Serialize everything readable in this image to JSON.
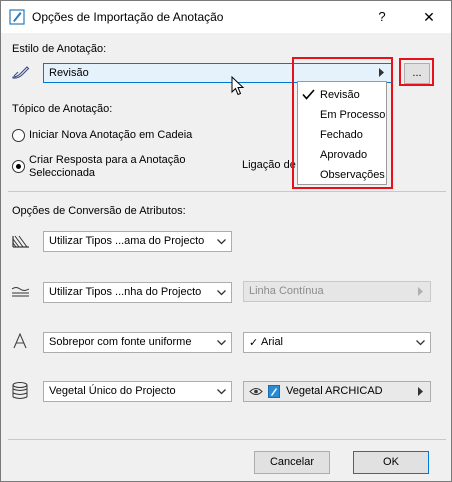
{
  "window": {
    "title": "Opções de Importação de Anotação",
    "help_glyph": "?",
    "close_glyph": "✕"
  },
  "style_section": {
    "label": "Estilo de Anotação:",
    "selected": "Revisão",
    "more_button": "...",
    "menu_items": [
      "Revisão",
      "Em Processo",
      "Fechado",
      "Aprovado",
      "Observações"
    ],
    "menu_checked_index": 0
  },
  "topic_section": {
    "label": "Tópico de Anotação:",
    "option_new": "Iniciar Nova Anotação em Cadeia",
    "option_reply_line1": "Criar Resposta para a Anotação",
    "option_reply_line2": "Seleccionada",
    "link_label": "Ligação de",
    "selected_option": "reply"
  },
  "conversion_section": {
    "label": "Opções de Conversão de Atributos:",
    "rows": [
      {
        "icon": "fill-pattern-icon",
        "combo": "Utilizar Tipos ...ama do Projecto"
      },
      {
        "icon": "line-type-icon",
        "combo": "Utilizar Tipos ...nha do Projecto",
        "secondary": "Linha Contínua",
        "secondary_disabled": true
      },
      {
        "icon": "font-icon",
        "combo": "Sobrepor com fonte uniforme",
        "secondary": "Arial",
        "secondary_check": "✓"
      },
      {
        "icon": "pen-set-icon",
        "combo": "Vegetal Único do Projecto",
        "secondary": "Vegetal ARCHICAD"
      }
    ]
  },
  "footer": {
    "cancel_label": "Cancelar",
    "ok_label": "OK"
  },
  "colors": {
    "highlight_red": "#e8101a",
    "accent_blue": "#0078d7"
  },
  "icons": [
    "app-icon",
    "help-icon",
    "close-icon",
    "pen-icon",
    "chevron-right-icon",
    "chevron-down-icon",
    "checkmark-icon",
    "eye-icon",
    "layer-icon",
    "mouse-cursor-icon"
  ]
}
